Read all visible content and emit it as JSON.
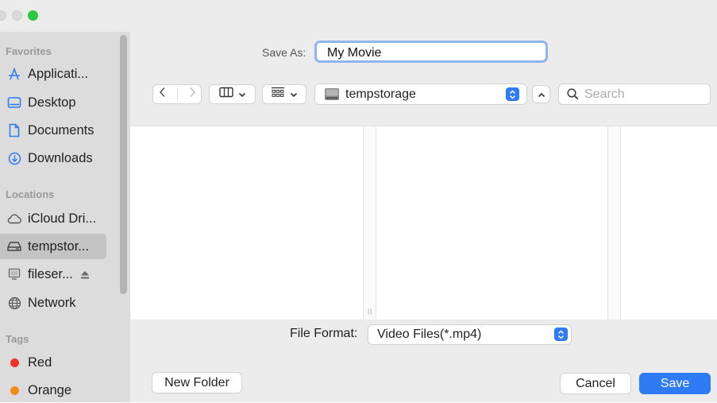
{
  "colors": {
    "accent": "#2f7bf4",
    "tag_red": "#e8332a",
    "tag_orange": "#f08c17",
    "close_light": "#d9d9d9",
    "zoom_light": "#2bc840"
  },
  "sidebar": {
    "favorites_heading": "Favorites",
    "favorites": [
      {
        "label": "Applicati...",
        "icon": "applications-icon"
      },
      {
        "label": "Desktop",
        "icon": "desktop-icon"
      },
      {
        "label": "Documents",
        "icon": "documents-icon"
      },
      {
        "label": "Downloads",
        "icon": "downloads-icon"
      }
    ],
    "locations_heading": "Locations",
    "locations": [
      {
        "label": "iCloud Dri...",
        "icon": "icloud-icon"
      },
      {
        "label": "tempstor...",
        "icon": "drive-icon",
        "selected": true
      },
      {
        "label": "fileser...",
        "icon": "server-icon"
      },
      {
        "label": "Network",
        "icon": "network-icon"
      }
    ],
    "tags_heading": "Tags",
    "tags": [
      {
        "label": "Red",
        "color": "#e8332a"
      },
      {
        "label": "Orange",
        "color": "#f08c17"
      }
    ]
  },
  "save": {
    "label": "Save As:",
    "value": "My Movie"
  },
  "toolbar": {
    "location": "tempstorage",
    "search_placeholder": "Search"
  },
  "format": {
    "label": "File Format:",
    "value": "Video Files(*.mp4)"
  },
  "buttons": {
    "new_folder": "New Folder",
    "cancel": "Cancel",
    "save": "Save"
  }
}
